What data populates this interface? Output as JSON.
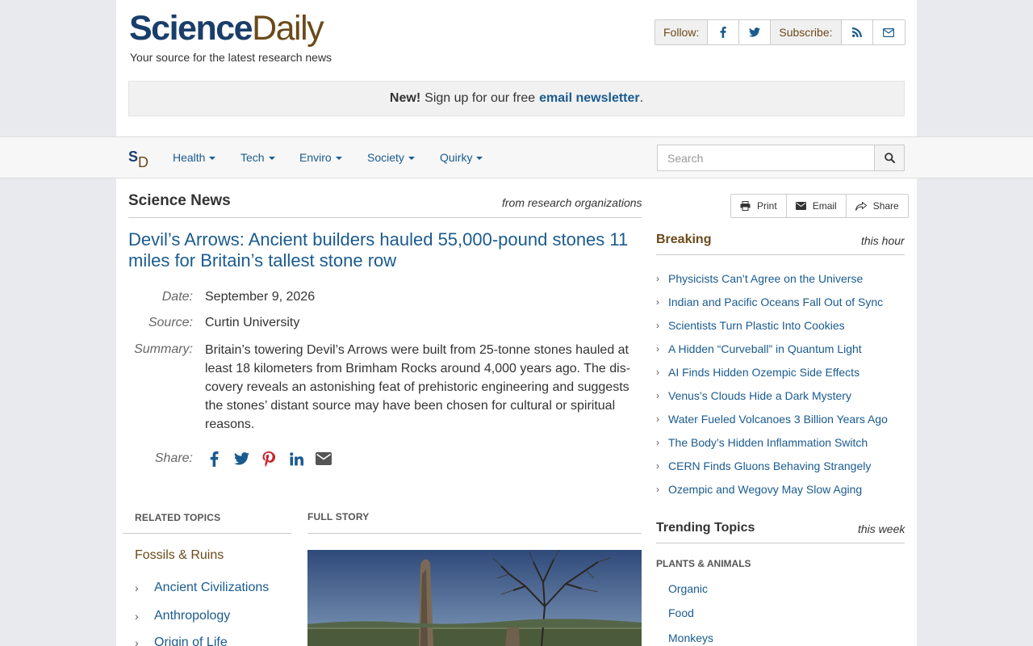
{
  "header": {
    "logo_science": "Science",
    "logo_daily": "Daily",
    "tagline": "Your source for the latest research news",
    "follow_label": "Follow:",
    "subscribe_label": "Subscribe:"
  },
  "newsletter": {
    "new_label": "New!",
    "text": "Sign up for our free",
    "link": "email newsletter",
    "period": "."
  },
  "nav": {
    "logo_s": "S",
    "logo_d": "D",
    "items": [
      "Health",
      "Tech",
      "Enviro",
      "Society",
      "Quirky"
    ],
    "search_placeholder": "Search"
  },
  "article": {
    "section_title": "Science News",
    "section_from": "from research organizations",
    "headline": "Devil’s Arrows: Ancient builders hauled 55,000-pound stones 11 miles for Britain’s tallest stone row",
    "date_label": "Date:",
    "date": "September 9, 2026",
    "source_label": "Source:",
    "source": "Curtin University",
    "summary_label": "Summary:",
    "summary": "Britain’s towering Devil’s Arrows were built from 25-tonne stones hauled at least 18 kilometers from Brimham Rocks around 4,000 years ago. The dis­covery reveals an astonishing feat of prehistoric engineering and suggests the stones’ distant source may have been chosen for cultural or spiritual reasons.",
    "share_label": "Share:"
  },
  "related": {
    "heading": "RELATED TOPICS",
    "main_topic": "Fossils & Ruins",
    "items": [
      "Ancient Civilizations",
      "Anthropology",
      "Origin of Life"
    ]
  },
  "full_story": {
    "heading": "FULL STORY"
  },
  "tools": {
    "print": "Print",
    "email": "Email",
    "share": "Share"
  },
  "breaking": {
    "title": "Breaking",
    "sub": "this hour",
    "items": [
      "Physicists Can’t Agree on the Universe",
      "Indian and Pacific Oceans Fall Out of Sync",
      "Scientists Turn Plastic Into Cookies",
      "A Hidden “Curveball” in Quantum Light",
      "AI Finds Hidden Ozempic Side Effects",
      "Venus’s Clouds Hide a Dark Mystery",
      "Water Fueled Volcanoes 3 Billion Years Ago",
      "The Body’s Hidden Inflammation Switch",
      "CERN Finds Gluons Behaving Strangely",
      "Ozempic and Wegovy May Slow Aging"
    ]
  },
  "trending": {
    "title": "Trending Topics",
    "sub": "this week",
    "category": "PLANTS & ANIMALS",
    "items": [
      "Organic",
      "Food",
      "Monkeys"
    ]
  },
  "colors": {
    "link_blue": "#1a5b8f",
    "brand_brown": "#6b4a1a",
    "brand_navy": "#1a3e6b"
  },
  "icons": [
    "facebook-icon",
    "twitter-icon",
    "rss-icon",
    "envelope-icon",
    "search-icon",
    "print-icon",
    "share-icon",
    "pinterest-icon",
    "linkedin-icon",
    "chevron-right-icon"
  ]
}
